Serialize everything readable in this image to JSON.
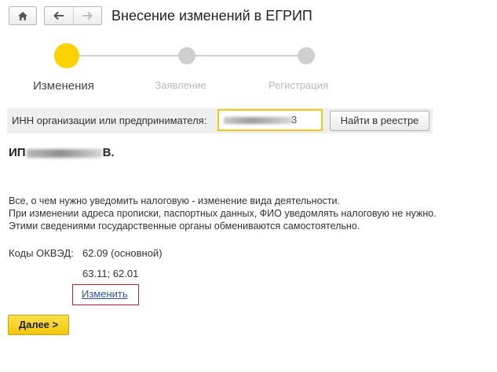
{
  "toolbar": {
    "home_icon": "home-icon",
    "back_icon": "arrow-left-icon",
    "forward_icon": "arrow-right-icon",
    "title": "Внесение изменений в ЕГРИП"
  },
  "steps": [
    {
      "label": "Изменения",
      "state": "active"
    },
    {
      "label": "Заявление",
      "state": "inactive"
    },
    {
      "label": "Регистрация",
      "state": "inactive"
    }
  ],
  "colors": {
    "step_active": "#fcd200",
    "step_inactive": "#cfcfcf",
    "accent_yellow": "#f5c518",
    "link": "#2a54a6",
    "highlight_border": "#c8202a"
  },
  "inn": {
    "label": "ИНН организации или предпринимателя:",
    "value_suffix": "3",
    "find_button": "Найти в реестре"
  },
  "person": {
    "prefix": "ИП",
    "suffix": "В."
  },
  "info": {
    "line1": "Все, о чем нужно уведомить налоговую - изменение вида деятельности.",
    "line2": "При изменении адреса прописки, паспортных данных, ФИО уведомлять налоговую не нужно.",
    "line3": "Этими сведениями государственные органы обмениваются самостоятельно."
  },
  "okved": {
    "label": "Коды ОКВЭД:",
    "main": "62.09 (основной)",
    "extra": "63.11; 62.01",
    "change_link": "Изменить"
  },
  "next_button": "Далее >"
}
